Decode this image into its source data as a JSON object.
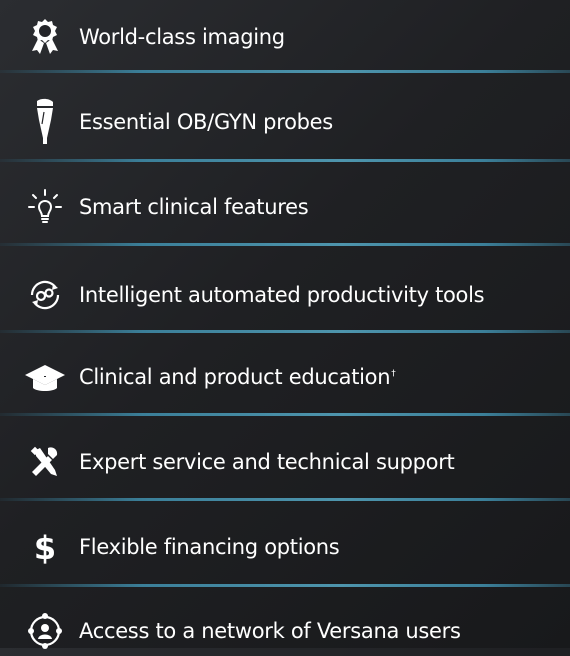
{
  "features": [
    {
      "icon": "award-ribbon-icon",
      "label": "World-class imaging"
    },
    {
      "icon": "ultrasound-probe-icon",
      "label": "Essential OB/GYN probes"
    },
    {
      "icon": "lightbulb-icon",
      "label": "Smart clinical features"
    },
    {
      "icon": "automation-gears-icon",
      "label": "Intelligent automated productivity tools"
    },
    {
      "icon": "graduation-cap-icon",
      "label": "Clinical and product education",
      "superscript": "†"
    },
    {
      "icon": "tools-icon",
      "label": "Expert service and technical support"
    },
    {
      "icon": "dollar-sign-icon",
      "label": "Flexible financing options"
    },
    {
      "icon": "user-network-icon",
      "label": "Access to a network of Versana users"
    }
  ],
  "colors": {
    "background": "#1f2023",
    "divider": "#4e95ad",
    "text": "#ffffff"
  }
}
